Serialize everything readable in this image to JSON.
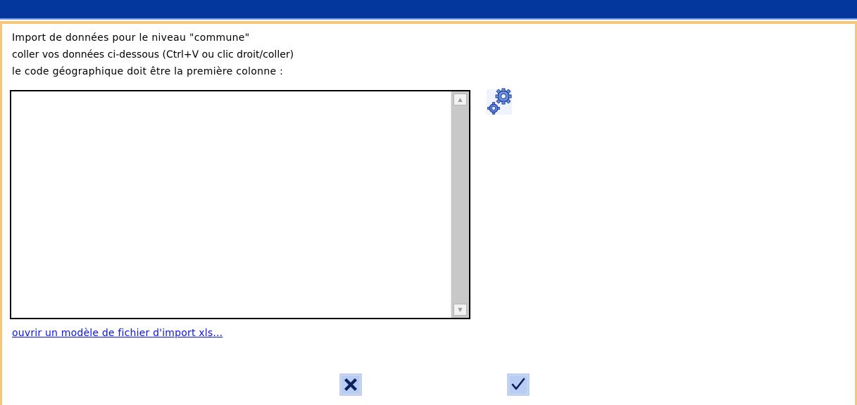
{
  "dialog": {
    "line1": "Import de données pour le niveau \"commune\"",
    "line2": "coller vos données ci-dessous (Ctrl+V ou clic droit/coller)",
    "line3": "le code géographique doit être la première colonne :"
  },
  "textarea": {
    "value": ""
  },
  "link": {
    "label": "ouvrir un modèle de fichier d'import xls... "
  },
  "icons": {
    "gear": "gear-icon",
    "cancel": "close-icon",
    "ok": "check-icon"
  },
  "colors": {
    "title_bar": "#04379d",
    "accent_border": "#f6c67a",
    "link": "#0b14e8",
    "icon_bg": "#b9cdf3"
  }
}
